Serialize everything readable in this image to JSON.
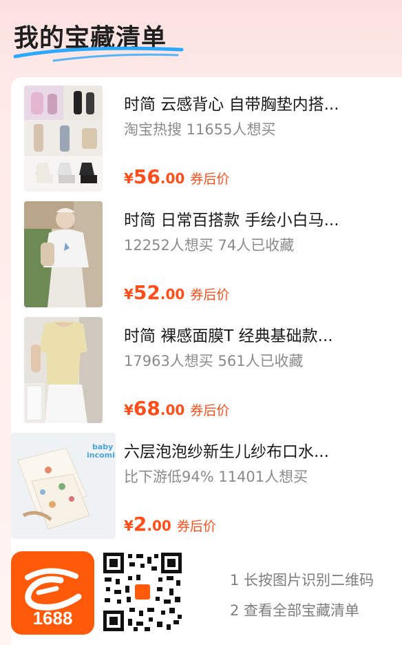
{
  "header": {
    "title": "我的宝藏清单"
  },
  "products": [
    {
      "title": "时简 云感背心 自带胸垫内搭...",
      "subtitle": "淘宝热搜 11655人想买",
      "price_symbol": "¥",
      "price_int": "56",
      "price_dec": ".00",
      "price_tag": "券后价"
    },
    {
      "title": "时简 日常百搭款 手绘小白马...",
      "subtitle": "12252人想买 74人已收藏",
      "price_symbol": "¥",
      "price_int": "52",
      "price_dec": ".00",
      "price_tag": "券后价"
    },
    {
      "title": "时简 裸感面膜T 经典基础款...",
      "subtitle": "17963人想买 561人已收藏",
      "price_symbol": "¥",
      "price_int": "68",
      "price_dec": ".00",
      "price_tag": "券后价"
    },
    {
      "title": "六层泡泡纱新生儿纱布口水...",
      "subtitle": "比下游低94% 11401人想买",
      "price_symbol": "¥",
      "price_int": "2",
      "price_dec": ".00",
      "price_tag": "券后价",
      "image_text": [
        "baby",
        "incoming"
      ]
    }
  ],
  "footer": {
    "logo_text": "1688",
    "step1": "1 长按图片识别二维码",
    "step2": "2 查看全部宝藏清单"
  },
  "colors": {
    "accent": "#ff4d1a",
    "brand": "#ff5a0a",
    "swoosh": "#2aa9ff"
  }
}
